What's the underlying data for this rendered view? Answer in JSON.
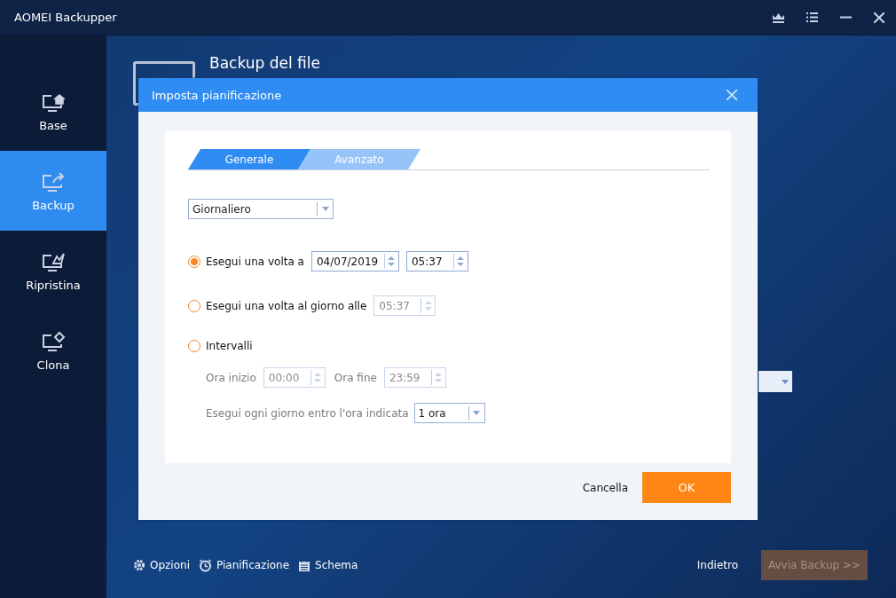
{
  "window": {
    "title": "AOMEI Backupper"
  },
  "sidebar": {
    "items": [
      {
        "kind": "home",
        "label": "Base",
        "selected": false
      },
      {
        "kind": "backup",
        "label": "Backup",
        "selected": true
      },
      {
        "kind": "restore",
        "label": "Ripristina",
        "selected": false
      },
      {
        "kind": "clone",
        "label": "Clona",
        "selected": false
      }
    ]
  },
  "main": {
    "title": "Backup del file",
    "footer": {
      "links": [
        {
          "kind": "gear",
          "label": "Opzioni"
        },
        {
          "kind": "alarm",
          "label": "Pianificazione"
        },
        {
          "kind": "calendar",
          "label": "Schema"
        }
      ],
      "back": "Indietro",
      "start": {
        "label": "Avvia Backup >>",
        "disabled": true
      }
    }
  },
  "dialog": {
    "title": "Imposta pianificazione",
    "tabs": [
      {
        "label": "Generale",
        "selected": true
      },
      {
        "label": "Avanzato",
        "selected": false
      }
    ],
    "frequency": "Giornaliero",
    "options": [
      {
        "label": "Esegui una volta a",
        "selected": true,
        "fields": [
          {
            "value": "04/07/2019",
            "disabled": false
          },
          {
            "value": "05:37",
            "disabled": false
          }
        ]
      },
      {
        "label": "Esegui una volta al giorno alle",
        "selected": false,
        "fields": [
          {
            "value": "05:37",
            "disabled": true
          }
        ]
      },
      {
        "label": "Intervalli",
        "selected": false
      }
    ],
    "intervals": {
      "start_label": "Ora inizio",
      "start": {
        "value": "00:00",
        "disabled": true
      },
      "end_label": "Ora fine",
      "end": {
        "value": "23:59",
        "disabled": true
      },
      "every_label": "Esegui ogni giorno entro l'ora indicata",
      "every": "1 ora"
    },
    "cancel": "Cancella",
    "ok": "OK"
  }
}
